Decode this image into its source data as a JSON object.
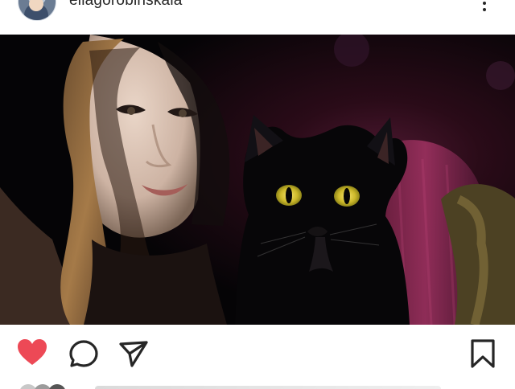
{
  "header": {
    "username": "ellagorobinskaia",
    "avatar_icon": "user-avatar",
    "more_icon": "more-vertical-icon"
  },
  "post": {
    "photo_subject": "selfie-with-black-cat",
    "liked": true
  },
  "actions": {
    "like_icon": "heart-filled-icon",
    "comment_icon": "comment-icon",
    "share_icon": "send-icon",
    "save_icon": "bookmark-icon"
  },
  "colors": {
    "like_red": "#ed4956",
    "icon_dark": "#262626",
    "divider": "#efefef"
  }
}
